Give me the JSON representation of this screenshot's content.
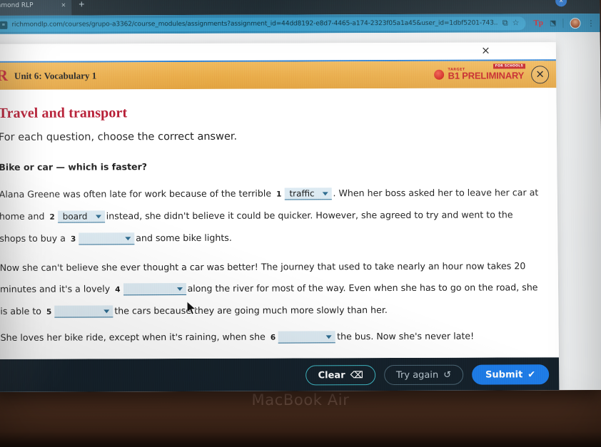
{
  "device": {
    "brand_label": "MacBook Air"
  },
  "browser": {
    "tab": {
      "title": "ichmond RLP",
      "close_icon": "×",
      "new_tab_icon": "+"
    },
    "window_control_icon": "×",
    "omnibox": {
      "site_icon": "≡",
      "url": "richmondlp.com/courses/grupo-a3362/course_modules/assignments?assignment_id=44dd8192-e8d7-4465-a174-2323f05a1a45&user_id=1dbf5201-743...",
      "share_icon": "⧉",
      "bookmark_icon": "☆"
    },
    "toolbar": {
      "extension_tp_label": "Tp",
      "extension_puzzle_icon": "⬔",
      "menu_icon": "⋮"
    }
  },
  "modal": {
    "top_close_icon": "×",
    "header": {
      "logo_letter": "R",
      "unit_title": "Unit 6: Vocabulary 1",
      "exam_target_label": "TARGET",
      "exam_level_label": "B1 PRELIMINARY",
      "exam_schools_label": "FOR SCHOOLS",
      "close_icon": "✕"
    },
    "exercise": {
      "title": "Travel and transport",
      "instruction": "For each question, choose the correct answer.",
      "question_prompt": "Bike or car — which is faster?",
      "paragraph1": {
        "seg_a": "Alana Greene was often late for work because of the terrible",
        "seg_b": ". When her boss asked her to leave her car at home and",
        "seg_c": "instead, she didn't believe it could be quicker. However, she agreed to try and went to the shops to buy a",
        "seg_d": "and some bike lights."
      },
      "paragraph2": {
        "seg_a": "Now she can't believe she ever thought a car was better! The journey that used to take nearly an hour now takes 20 minutes and it's a lovely",
        "seg_b": "along the river for most of the way. Even when she has to go on the road, she is able to",
        "seg_c": "the cars because they are going much more slowly than her."
      },
      "paragraph3": {
        "seg_a": "She loves her bike ride, except when it's raining, when she",
        "seg_b": "the bus. Now she's never late!"
      },
      "gaps": [
        {
          "number": "1",
          "value": "traffic",
          "caret_icon": "▾"
        },
        {
          "number": "2",
          "value": "board",
          "caret_icon": "▾"
        },
        {
          "number": "3",
          "value": "",
          "caret_icon": "▾"
        },
        {
          "number": "4",
          "value": "",
          "caret_icon": "▾"
        },
        {
          "number": "5",
          "value": "",
          "caret_icon": "▾"
        },
        {
          "number": "6",
          "value": "",
          "caret_icon": "▾"
        }
      ]
    },
    "footer": {
      "clear_label": "Clear",
      "clear_icon": "⌫",
      "try_again_label": "Try again",
      "try_again_icon": "↺",
      "submit_label": "Submit",
      "submit_icon": "✔"
    }
  },
  "colors": {
    "brand_red": "#b3122b",
    "band_orange": "#e9aa45",
    "submit_blue": "#1e7ce8",
    "clear_teal": "#3fb8c4",
    "gap_fill": "#dceaf2",
    "footer_dark": "#15212b"
  }
}
